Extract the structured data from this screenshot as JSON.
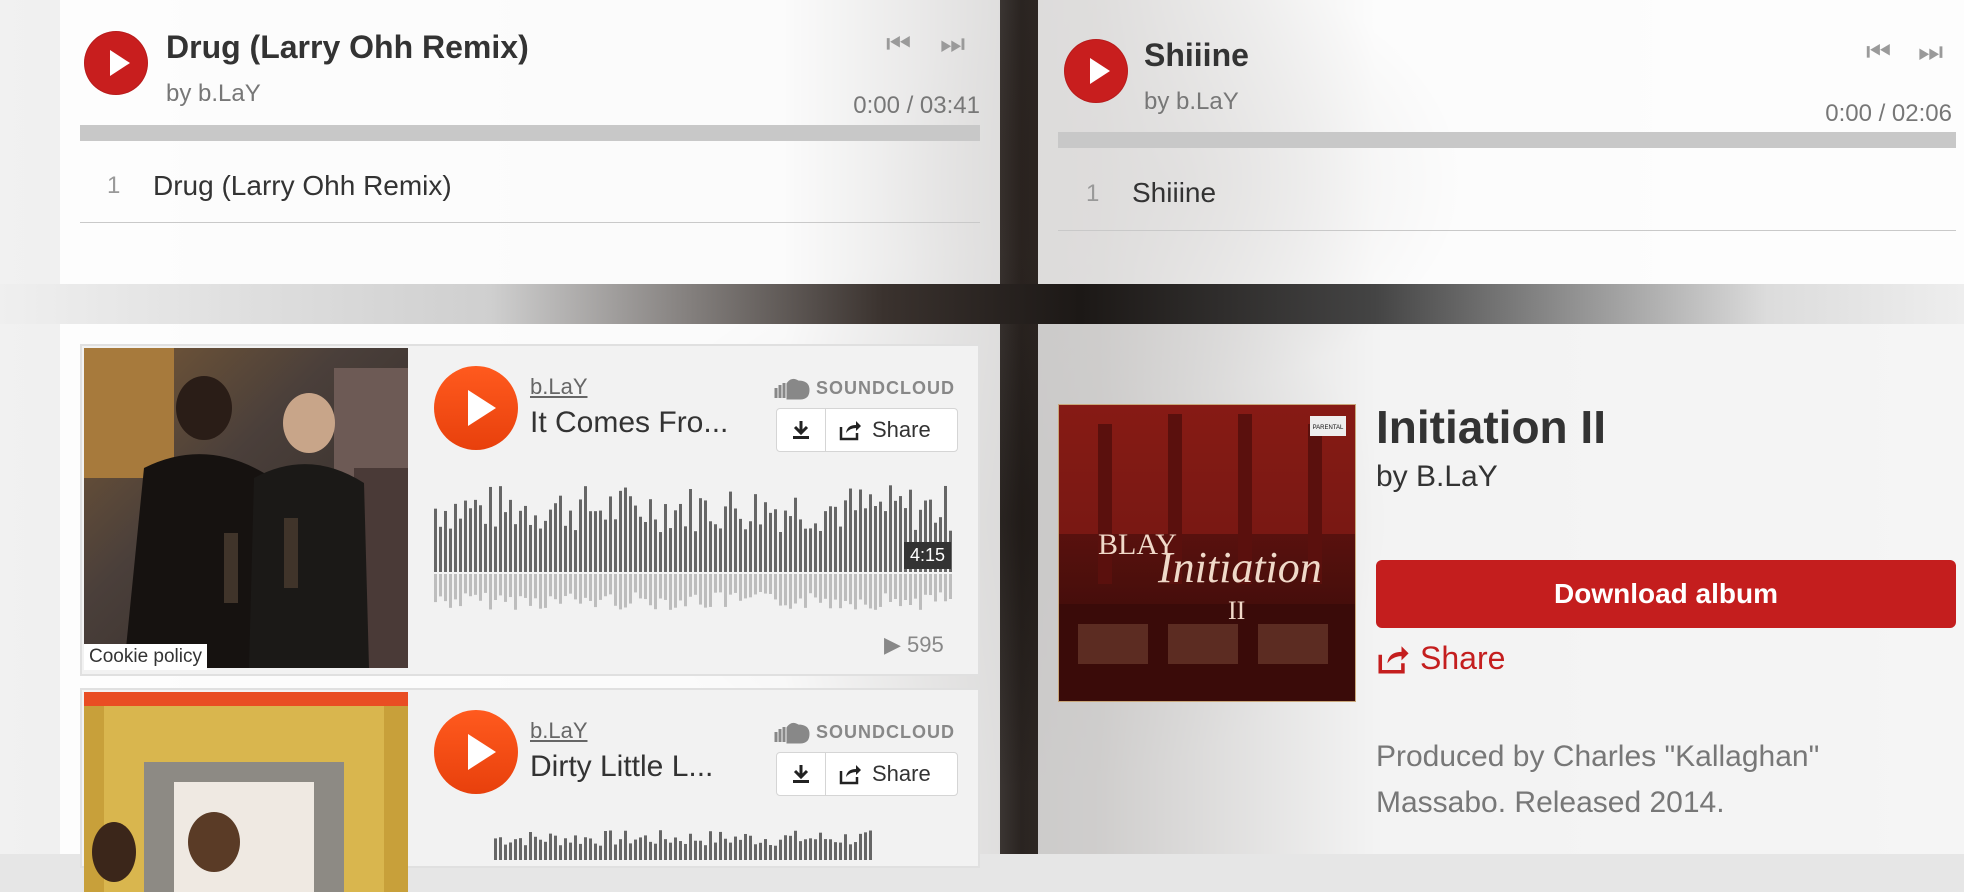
{
  "player1": {
    "title": "Drug (Larry Ohh Remix)",
    "by": "by b.LaY",
    "time": "0:00 / 03:41",
    "track_num": "1",
    "track_title": "Drug (Larry Ohh Remix)"
  },
  "player2": {
    "title": "Shiiine",
    "by": "by b.LaY",
    "time": "0:00 / 02:06",
    "track_num": "1",
    "track_title": "Shiiine"
  },
  "soundcloud": [
    {
      "user": "b.LaY",
      "track": "It Comes Fro...",
      "logo": "SOUNDCLOUD",
      "share": "Share",
      "duration": "4:15",
      "plays": "595"
    },
    {
      "user": "b.LaY",
      "track": "Dirty Little L...",
      "logo": "SOUNDCLOUD",
      "share": "Share"
    }
  ],
  "cookie_policy": "Cookie policy",
  "album": {
    "title": "Initiation II",
    "by": "by B.LaY",
    "download_label": "Download album",
    "share_label": "Share",
    "description_line1": "Produced by Charles \"Kallaghan\"",
    "description_line2": "Massabo. Released 2014.",
    "cover_logo": "BLAY",
    "cover_title": "Initiation",
    "cover_numeral": "II",
    "cover_badge": "PARENTAL"
  },
  "colors": {
    "accent": "#c41e1e",
    "soundcloud": "#ff5500"
  },
  "icons": [
    "play-icon",
    "skip-back-icon",
    "skip-forward-icon",
    "download-icon",
    "share-icon",
    "soundcloud-icon"
  ]
}
